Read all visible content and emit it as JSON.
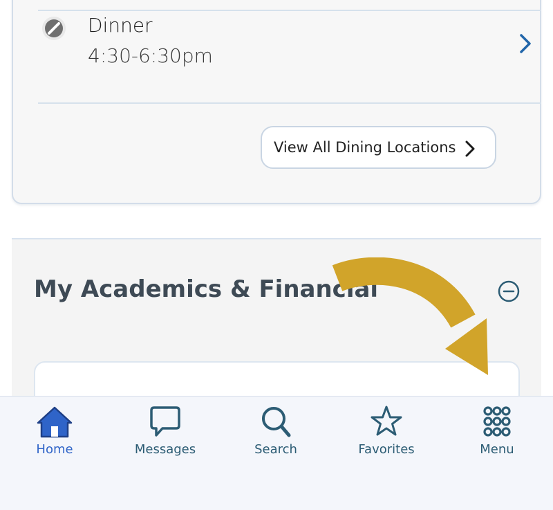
{
  "dining": {
    "meal_name": "Dinner",
    "meal_time": "4:30-6:30pm",
    "view_all_label": "View All Dining Locations"
  },
  "academics": {
    "title": "My Academics & Financial"
  },
  "tabbar": {
    "items": [
      {
        "label": "Home",
        "icon": "home-icon",
        "active": true
      },
      {
        "label": "Messages",
        "icon": "chat-bubble-icon",
        "active": false
      },
      {
        "label": "Search",
        "icon": "search-icon",
        "active": false
      },
      {
        "label": "Favorites",
        "icon": "star-icon",
        "active": false
      },
      {
        "label": "Menu",
        "icon": "grid-dots-icon",
        "active": false
      }
    ]
  },
  "colors": {
    "accent_active": "#2f64c8",
    "tab_icon": "#2c5c74",
    "chevron_blue": "#2266aa",
    "arrow_gold": "#d1a42a"
  }
}
